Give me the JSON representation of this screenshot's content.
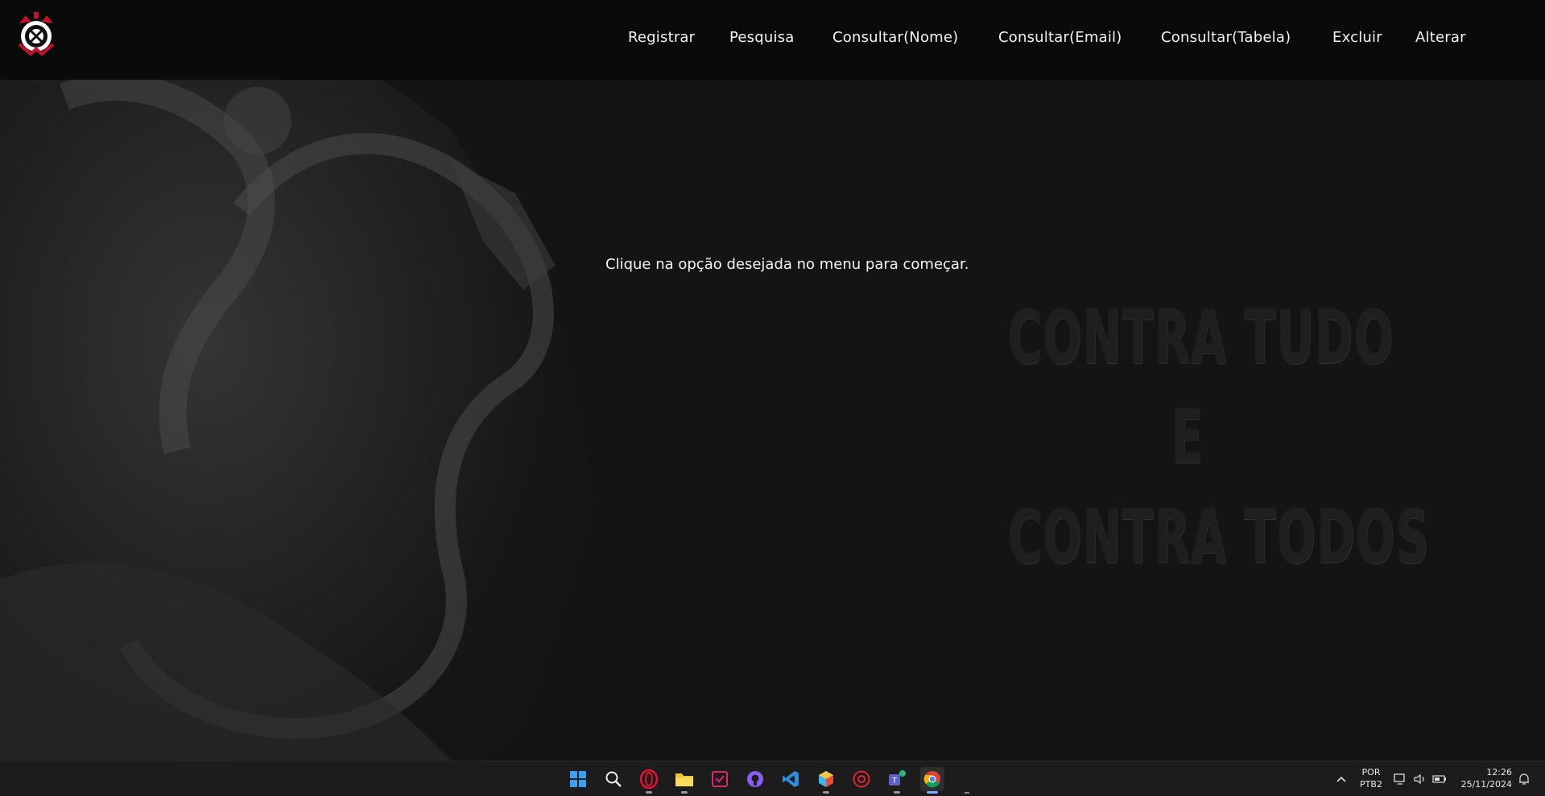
{
  "nav": {
    "logo_name": "corinthians-crest",
    "items": [
      "Registrar",
      "Pesquisa",
      "Consultar(Nome)",
      "Consultar(Email)",
      "Consultar(Tabela)",
      "Excluir",
      "Alterar"
    ]
  },
  "main": {
    "prompt": "Clique na opção desejada no menu para começar.",
    "slogan_lines": [
      "CONTRA TUDO",
      "E",
      "CONTRA TODOS"
    ]
  },
  "taskbar": {
    "apps": [
      "windows-start",
      "search",
      "opera",
      "file-explorer",
      "app-checkbox",
      "github-desktop",
      "vscode",
      "app-hexagon",
      "app-red-round",
      "teams",
      "chrome"
    ],
    "language": "POR",
    "layout": "PTB2",
    "time": "12:26",
    "date": "25/11/2024"
  },
  "colors": {
    "background": "#141414",
    "nav": "#0a0a0a",
    "accent": "#c8102e"
  }
}
